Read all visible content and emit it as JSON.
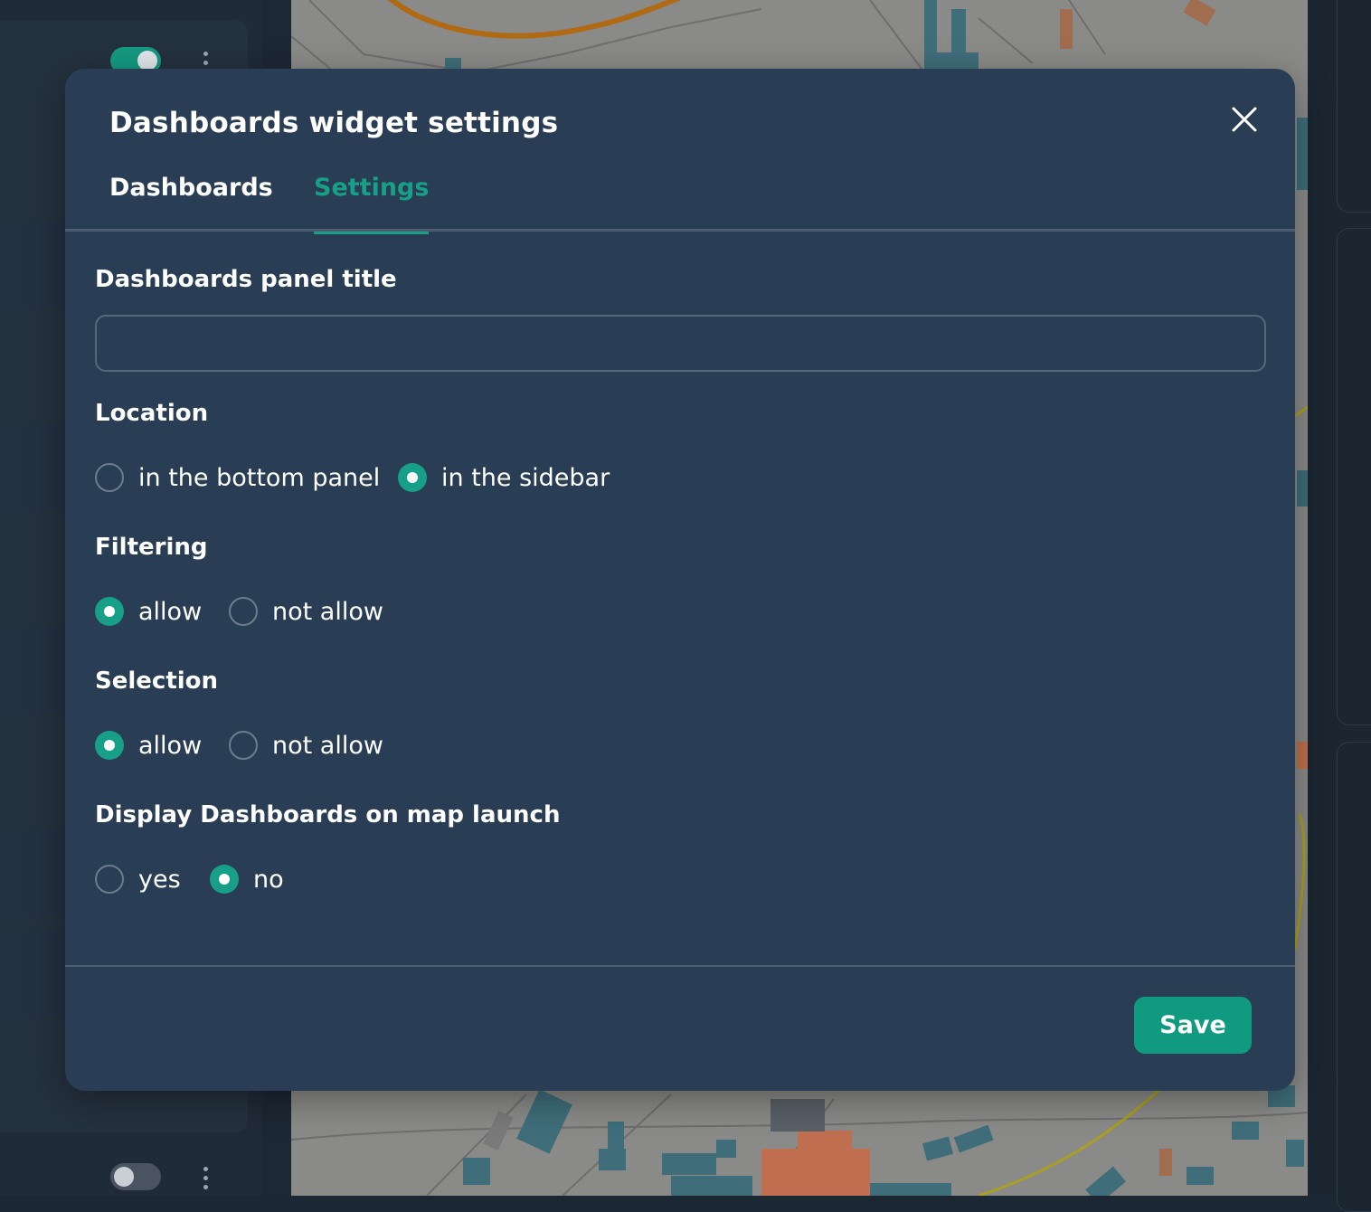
{
  "modal": {
    "title": "Dashboards widget settings",
    "close_icon": "close-icon"
  },
  "tabs": [
    {
      "label": "Dashboards",
      "active": false
    },
    {
      "label": "Settings",
      "active": true
    }
  ],
  "form": {
    "panel_title": {
      "label": "Dashboards panel title",
      "value": "",
      "placeholder": ""
    },
    "location": {
      "label": "Location",
      "options": [
        {
          "label": "in the bottom panel",
          "checked": false
        },
        {
          "label": "in the sidebar",
          "checked": true
        }
      ]
    },
    "filtering": {
      "label": "Filtering",
      "options": [
        {
          "label": "allow",
          "checked": true
        },
        {
          "label": "not allow",
          "checked": false
        }
      ]
    },
    "selection": {
      "label": "Selection",
      "options": [
        {
          "label": "allow",
          "checked": true
        },
        {
          "label": "not allow",
          "checked": false
        }
      ]
    },
    "display_on_launch": {
      "label": "Display Dashboards on map launch",
      "options": [
        {
          "label": "yes",
          "checked": false
        },
        {
          "label": "no",
          "checked": true
        }
      ]
    }
  },
  "footer": {
    "save_label": "Save"
  },
  "colors": {
    "accent": "#17a087",
    "modal_bg": "#293e54",
    "overlay_bg": "#1c2834"
  }
}
